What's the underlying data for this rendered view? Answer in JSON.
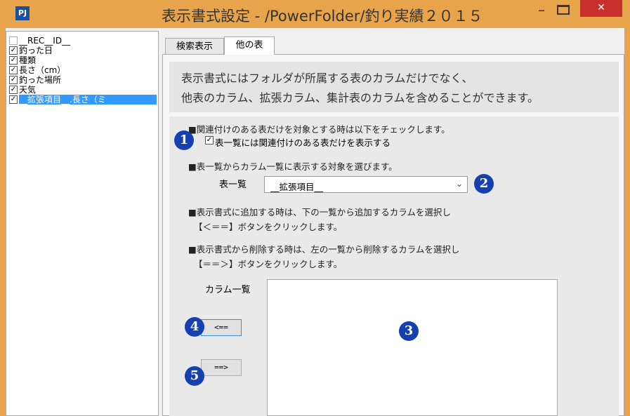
{
  "window": {
    "app_icon_text": "PJ",
    "title": "表示書式設定 - /PowerFolder/釣り実績２０１５",
    "minimize_glyph": "–",
    "close_glyph": "✕"
  },
  "column_list": {
    "items": [
      {
        "label": "__REC__ID__",
        "checked": false
      },
      {
        "label": "釣った日",
        "checked": true
      },
      {
        "label": "種類",
        "checked": true
      },
      {
        "label": "長さ（cm）",
        "checked": true
      },
      {
        "label": "釣った場所",
        "checked": true
      },
      {
        "label": "天気",
        "checked": true
      },
      {
        "label": "__拡張項目__.長さ（ミ",
        "checked": true,
        "selected": true
      }
    ],
    "check_glyph": "✓"
  },
  "tabs": [
    {
      "label": "検索表示",
      "active": false
    },
    {
      "label": "他の表",
      "active": true
    }
  ],
  "description": {
    "line1": "表示書式にはフォルダが所属する表のカラムだけでなく、",
    "line2": "他表のカラム、拡張カラム、集計表のカラムを含めることができます。"
  },
  "options": {
    "related_note": "■関連付けのある表だけを対象とする時は以下をチェックします。",
    "related_checkbox_label": "表一覧には関連付けのある表だけを表示する",
    "related_checked": true,
    "select_note": "■表一覧からカラム一覧に表示する対象を選びます。",
    "tables_label": "表一覧",
    "tables_selected": "__拡張項目__",
    "dropdown_glyph": "⌄",
    "add_note_line1": "■表示書式に追加する時は、下の一覧から追加するカラムを選択し",
    "add_note_line2": "【＜＝＝】ボタンをクリックします。",
    "remove_note_line1": "■表示書式から削除する時は、左の一覧から削除するカラムを選択し",
    "remove_note_line2": "【＝＝＞】ボタンをクリックします。",
    "columns_label": "カラム一覧",
    "add_button": "<==",
    "remove_button": "==>"
  },
  "badges": [
    "1",
    "2",
    "3",
    "4",
    "5"
  ],
  "colors": {
    "titlebar": "#e8a44a",
    "close": "#c7302b",
    "selection": "#3399ff",
    "badge": "#1640b0"
  }
}
